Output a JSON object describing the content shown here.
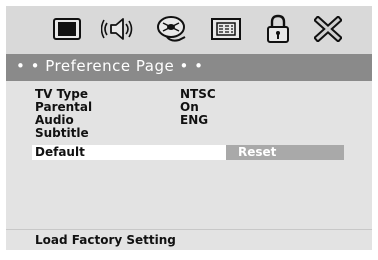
{
  "icons": [
    {
      "name": "tv-icon"
    },
    {
      "name": "speaker-icon"
    },
    {
      "name": "video-icon"
    },
    {
      "name": "menu-icon"
    },
    {
      "name": "lock-icon"
    },
    {
      "name": "close-icon"
    }
  ],
  "header": {
    "title": "• • Preference Page • •"
  },
  "settings": [
    {
      "label": "TV Type",
      "value": "NTSC"
    },
    {
      "label": "Parental",
      "value": "On"
    },
    {
      "label": "Audio",
      "value": "ENG"
    },
    {
      "label": "Subtitle",
      "value": ""
    },
    {
      "label": "Default",
      "value": ""
    }
  ],
  "option": {
    "reset_label": "Reset"
  },
  "footer": {
    "hint": "Load Factory Setting"
  }
}
